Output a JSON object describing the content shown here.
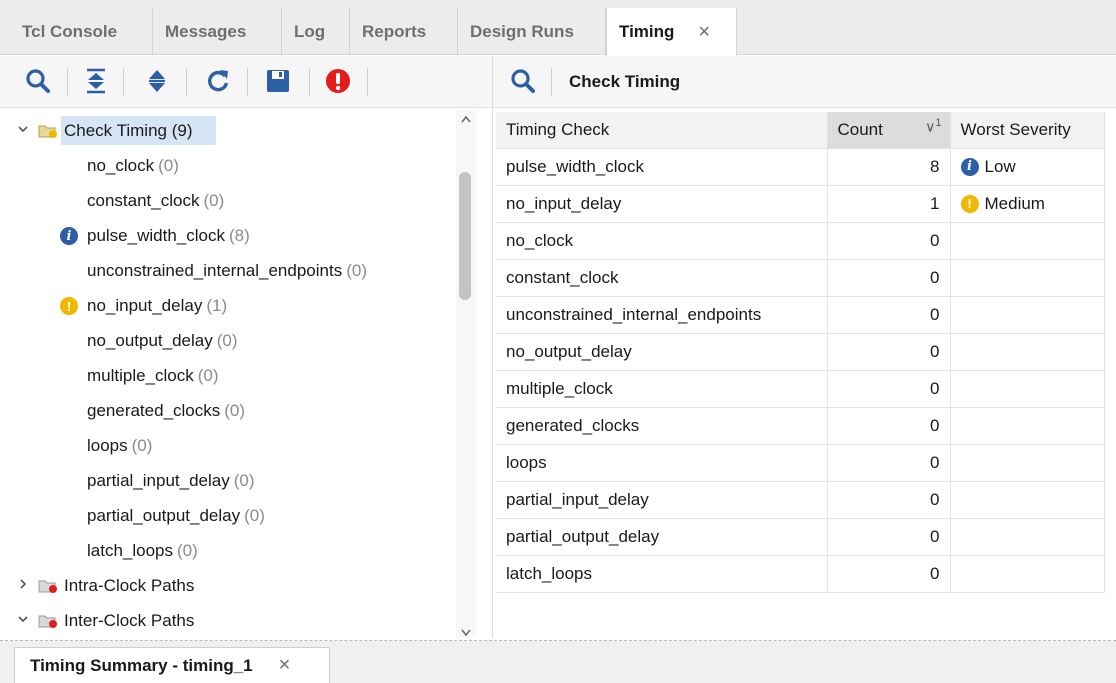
{
  "tabs": [
    {
      "label": "Tcl Console",
      "active": false
    },
    {
      "label": "Messages",
      "active": false
    },
    {
      "label": "Log",
      "active": false
    },
    {
      "label": "Reports",
      "active": false
    },
    {
      "label": "Design Runs",
      "active": false
    },
    {
      "label": "Timing",
      "active": true,
      "close": "×"
    }
  ],
  "toolbar": {
    "icons": [
      "search-icon",
      "collapse-all-icon",
      "expand-all-icon",
      "refresh-icon",
      "save-icon",
      "error-icon"
    ]
  },
  "tree": {
    "root": {
      "label": "Check Timing",
      "count": "(9)"
    },
    "children": [
      {
        "label": "no_clock",
        "count": "(0)",
        "severity": ""
      },
      {
        "label": "constant_clock",
        "count": "(0)",
        "severity": ""
      },
      {
        "label": "pulse_width_clock",
        "count": "(8)",
        "severity": "info"
      },
      {
        "label": "unconstrained_internal_endpoints",
        "count": "(0)",
        "severity": ""
      },
      {
        "label": "no_input_delay",
        "count": "(1)",
        "severity": "warning"
      },
      {
        "label": "no_output_delay",
        "count": "(0)",
        "severity": ""
      },
      {
        "label": "multiple_clock",
        "count": "(0)",
        "severity": ""
      },
      {
        "label": "generated_clocks",
        "count": "(0)",
        "severity": ""
      },
      {
        "label": "loops",
        "count": "(0)",
        "severity": ""
      },
      {
        "label": "partial_input_delay",
        "count": "(0)",
        "severity": ""
      },
      {
        "label": "partial_output_delay",
        "count": "(0)",
        "severity": ""
      },
      {
        "label": "latch_loops",
        "count": "(0)",
        "severity": ""
      }
    ],
    "groups": [
      {
        "label": "Intra-Clock Paths",
        "expanded": false
      },
      {
        "label": "Inter-Clock Paths",
        "expanded": true
      }
    ]
  },
  "right": {
    "title": "Check Timing",
    "columns": [
      "Timing Check",
      "Count",
      "Worst Severity"
    ],
    "sort_indicator": "1",
    "rows": [
      {
        "check": "pulse_width_clock",
        "count": "8",
        "severity": "Low",
        "icon": "info"
      },
      {
        "check": "no_input_delay",
        "count": "1",
        "severity": "Medium",
        "icon": "warning"
      },
      {
        "check": "no_clock",
        "count": "0",
        "severity": "",
        "icon": ""
      },
      {
        "check": "constant_clock",
        "count": "0",
        "severity": "",
        "icon": ""
      },
      {
        "check": "unconstrained_internal_endpoints",
        "count": "0",
        "severity": "",
        "icon": ""
      },
      {
        "check": "no_output_delay",
        "count": "0",
        "severity": "",
        "icon": ""
      },
      {
        "check": "multiple_clock",
        "count": "0",
        "severity": "",
        "icon": ""
      },
      {
        "check": "generated_clocks",
        "count": "0",
        "severity": "",
        "icon": ""
      },
      {
        "check": "loops",
        "count": "0",
        "severity": "",
        "icon": ""
      },
      {
        "check": "partial_input_delay",
        "count": "0",
        "severity": "",
        "icon": ""
      },
      {
        "check": "partial_output_delay",
        "count": "0",
        "severity": "",
        "icon": ""
      },
      {
        "check": "latch_loops",
        "count": "0",
        "severity": "",
        "icon": ""
      }
    ]
  },
  "bottom_tab": {
    "label": "Timing Summary - timing_1",
    "close": "×"
  },
  "colors": {
    "accent_blue": "#2d5fa6",
    "warning_yellow": "#f0b800",
    "error_red": "#e31b1b",
    "selection": "#d6e5f5"
  }
}
